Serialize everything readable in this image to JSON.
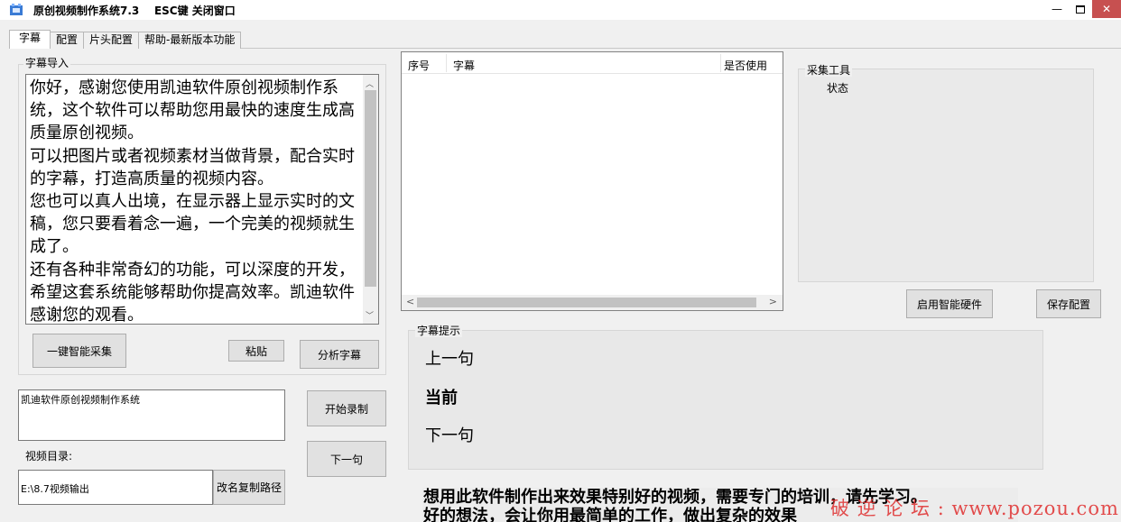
{
  "window": {
    "title": "原创视频制作系统7.3    ESC键 关闭窗口",
    "minimize_glyph": "—",
    "close_glyph": "✕"
  },
  "tabs": [
    {
      "label": "字幕",
      "active": true
    },
    {
      "label": "配置",
      "active": false
    },
    {
      "label": "片头配置",
      "active": false
    },
    {
      "label": "帮助-最新版本功能",
      "active": false
    }
  ],
  "import_panel": {
    "label": "字幕导入",
    "text": "你好，感谢您使用凯迪软件原创视频制作系统，这个软件可以帮助您用最快的速度生成高质量原创视频。\n可以把图片或者视频素材当做背景，配合实时的字幕，打造高质量的视频内容。\n您也可以真人出境，在显示器上显示实时的文稿，您只要看着念一遍，一个完美的视频就生成了。\n还有各种非常奇幻的功能，可以深度的开发，希望这套系统能够帮助你提高效率。凯迪软件感谢您的观看。",
    "one_key_label": "一键智能采集",
    "paste_label": "粘贴",
    "analyze_label": "分析字幕"
  },
  "record_panel": {
    "name_value": "凯迪软件原创视频制作系统",
    "start_label": "开始录制",
    "next_label": "下一句",
    "dir_label": "视频目录:",
    "path_value": "E:\\8.7视频输出",
    "rename_label": "改名复制路径"
  },
  "sentence_list": {
    "columns": [
      "序号",
      "字幕",
      "是否使用"
    ],
    "rows": []
  },
  "collect_panel": {
    "label": "采集工具",
    "status_label": "状态",
    "smart_hw_label": "启用智能硬件",
    "save_config_label": "保存配置"
  },
  "hint_panel": {
    "label": "字幕提示",
    "prev": "上一句",
    "current": "当前",
    "next": "下一句"
  },
  "notice": {
    "text": "想用此软件制作出来效果特别好的视频，需要专门的培训，请先学习。\n好的想法，会让你用最简单的工作，做出复杂的效果"
  },
  "watermark": {
    "text": "破 逆 论 坛 : www.pozou.com"
  },
  "colors": {
    "close_button": "#c75050",
    "watermark": "#e03030"
  }
}
